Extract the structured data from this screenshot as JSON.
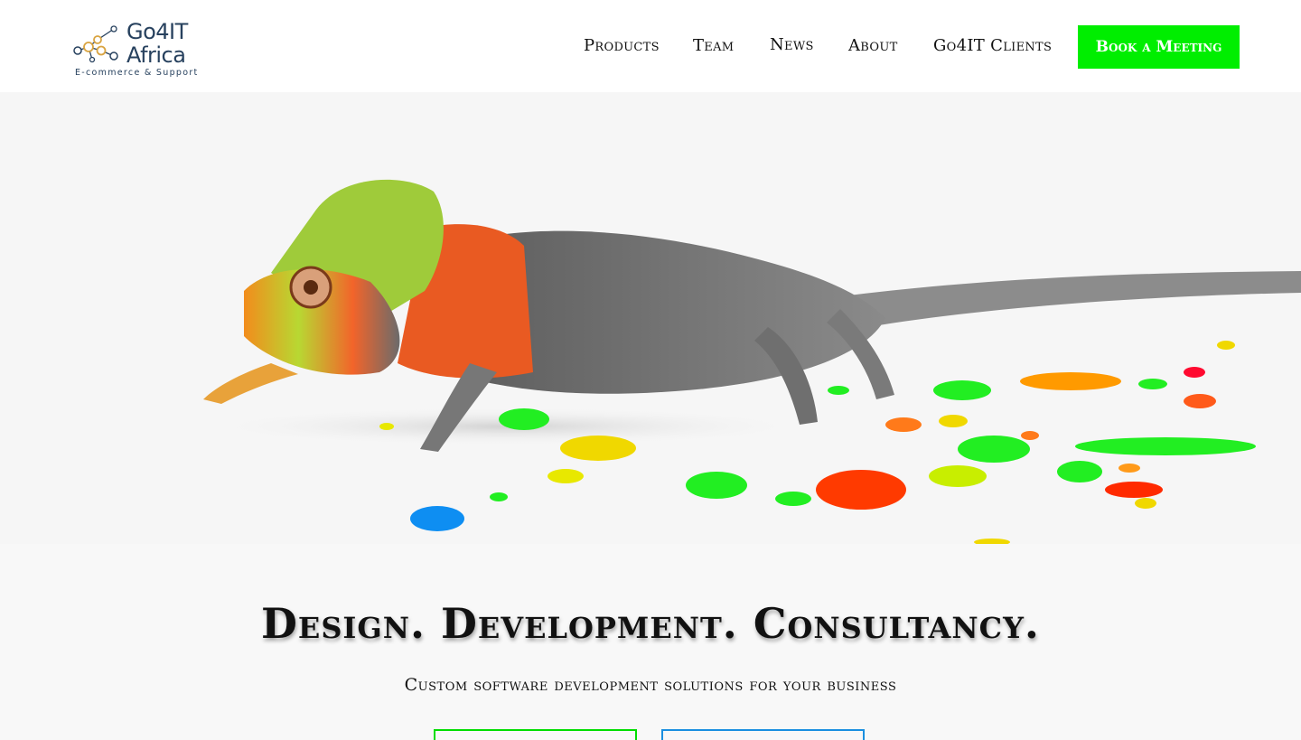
{
  "logo": {
    "line1": "Go4IT",
    "line2": "Africa",
    "tagline": "E-commerce & Support"
  },
  "nav": {
    "items": [
      {
        "label": "Products"
      },
      {
        "label": "Team"
      },
      {
        "label": "News"
      },
      {
        "label": "About"
      },
      {
        "label": "Go4IT Clients"
      }
    ],
    "cta_label": "Book a Meeting"
  },
  "hero": {
    "headline": "Design. Development. Consultancy.",
    "subheadline": "Custom software development solutions for your business"
  },
  "colors": {
    "accent_green": "#00ee00",
    "accent_blue": "#1a8fe0",
    "logo_navy": "#27415e",
    "logo_gold": "#d9a441"
  }
}
